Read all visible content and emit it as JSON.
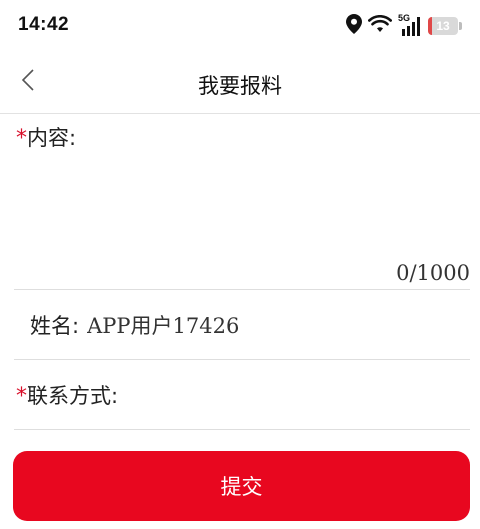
{
  "status_bar": {
    "time": "14:42",
    "network_label": "5G",
    "battery_text": "13",
    "battery_level": 0.13,
    "icons": [
      "location-pin-icon",
      "wifi-icon",
      "cellular-signal-icon",
      "battery-icon"
    ]
  },
  "nav": {
    "title": "我要报料",
    "back_icon": "chevron-left-icon"
  },
  "form": {
    "required_mark": "*",
    "content": {
      "label": "内容:",
      "value": "",
      "counter": "0/1000"
    },
    "name": {
      "label": "姓名:",
      "value": "APP用户17426"
    },
    "contact": {
      "label": "联系方式:",
      "value": ""
    },
    "submit_label": "提交"
  },
  "colors": {
    "accent": "#e8071f",
    "required": "#d8102b",
    "battery_low": "#e04848"
  }
}
